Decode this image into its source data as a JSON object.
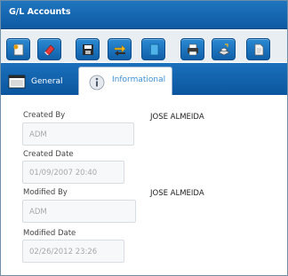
{
  "window": {
    "title": "G/L Accounts"
  },
  "toolbar": {
    "buttons": [
      {
        "icon": "new-document-icon"
      },
      {
        "icon": "eraser-icon"
      },
      {
        "icon": "save-icon"
      },
      {
        "icon": "refresh-icon"
      },
      {
        "icon": "book-icon"
      },
      {
        "icon": "print-icon"
      },
      {
        "icon": "export-icon"
      },
      {
        "icon": "document-icon"
      }
    ]
  },
  "tabs": [
    {
      "label": "General",
      "active": false,
      "icon": "window-icon"
    },
    {
      "label": "Informational",
      "active": true,
      "icon": "info-icon"
    }
  ],
  "form": {
    "created_by": {
      "label": "Created By",
      "value": "ADM",
      "display_name": "JOSE ALMEIDA"
    },
    "created_date": {
      "label": "Created Date",
      "value": "01/09/2007 20:40"
    },
    "modified_by": {
      "label": "Modified By",
      "value": "ADM",
      "display_name": "JOSE ALMEIDA"
    },
    "modified_date": {
      "label": "Modified Date",
      "value": "02/26/2012 23:26"
    }
  },
  "colors": {
    "title_bar": "#1565b0",
    "tab_active_text": "#3d8fd6",
    "toolbar_button": "#1a72c0"
  }
}
